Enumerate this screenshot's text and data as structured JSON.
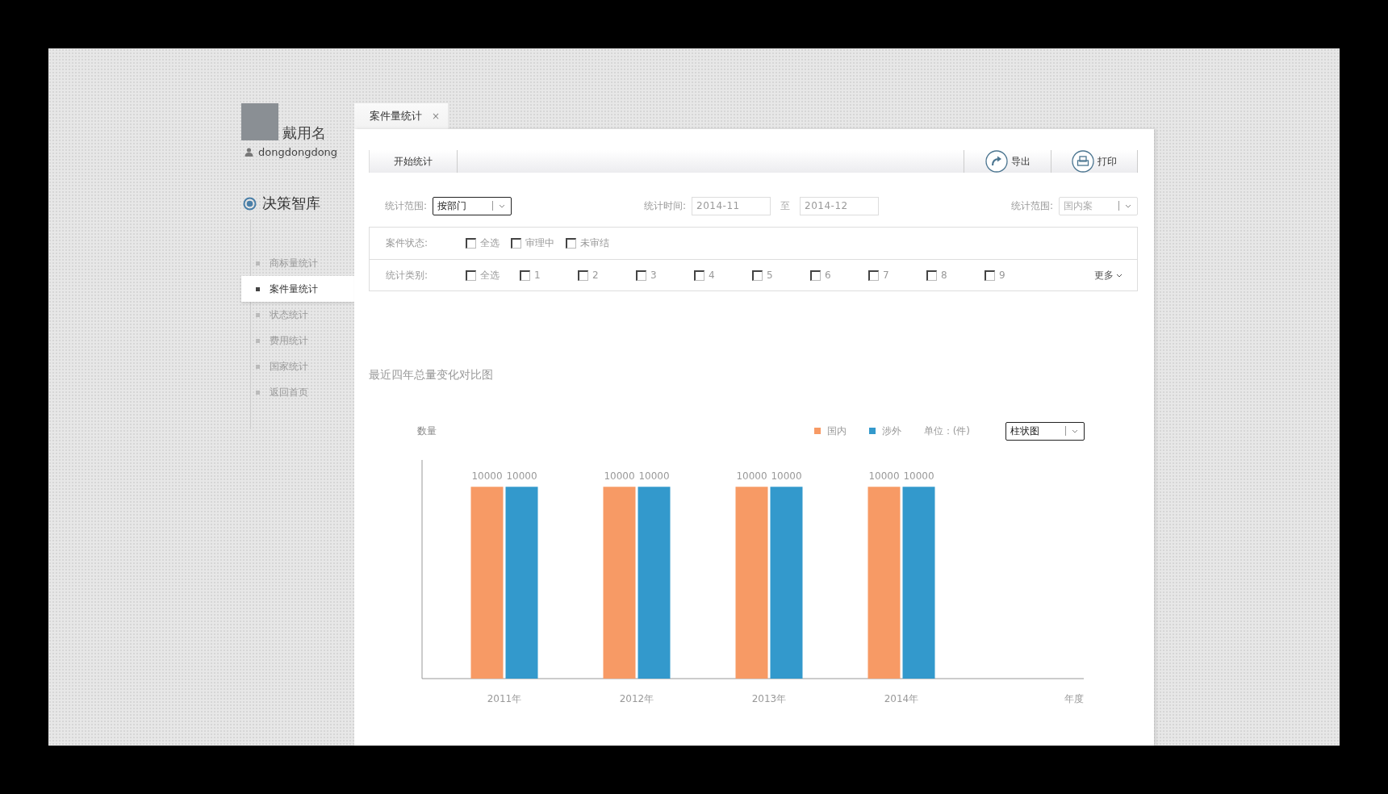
{
  "profile": {
    "name": "戴用名",
    "username": "dongdongdong"
  },
  "sidebar": {
    "title": "决策智库",
    "items": [
      {
        "label": "商标量统计",
        "selected": false
      },
      {
        "label": "案件量统计",
        "selected": true
      },
      {
        "label": "状态统计",
        "selected": false
      },
      {
        "label": "费用统计",
        "selected": false
      },
      {
        "label": "国家统计",
        "selected": false
      },
      {
        "label": "返回首页",
        "selected": false
      }
    ]
  },
  "tabs": [
    {
      "label": "案件量统计",
      "selected": true,
      "close": "×"
    }
  ],
  "toolbar": {
    "start": "开始统计",
    "actions": [
      {
        "label": "导出",
        "kind": "export"
      },
      {
        "label": "打印",
        "kind": "print"
      }
    ]
  },
  "filters": {
    "scope": {
      "label": "统计范围:",
      "value": "按部门",
      "disabled": false
    },
    "time": {
      "label": "统计时间:",
      "from": "2014-11",
      "separator": "至",
      "to": "2014-12"
    },
    "scope_right": {
      "label": "统计范围:",
      "value": "国内案",
      "disabled": true
    }
  },
  "status_row": {
    "label": "案件状态:",
    "options": [
      {
        "label": "全选",
        "checked": false
      },
      {
        "label": "审理中",
        "checked": false
      },
      {
        "label": "未审结",
        "checked": false
      }
    ]
  },
  "category_row": {
    "label": "统计类别:",
    "options": [
      {
        "label": "全选",
        "checked": false
      },
      {
        "label": "1",
        "checked": false
      },
      {
        "label": "2",
        "checked": false
      },
      {
        "label": "3",
        "checked": false
      },
      {
        "label": "4",
        "checked": false
      },
      {
        "label": "5",
        "checked": false
      },
      {
        "label": "6",
        "checked": false
      },
      {
        "label": "7",
        "checked": false
      },
      {
        "label": "8",
        "checked": false
      },
      {
        "label": "9",
        "checked": false
      }
    ],
    "more": "更多"
  },
  "chart": {
    "unit": "单位：(件)",
    "chart_type": {
      "value": "柱状图",
      "disabled": false
    },
    "chart_data": {
      "type": "bar",
      "title": "最近四年总量变化对比图",
      "annotations": [
        {
          "text": "年度"
        }
      ],
      "ylabel": "数量",
      "categories": [
        "2011年",
        "2012年",
        "2013年",
        "2014年"
      ],
      "series": [
        {
          "name": "国内",
          "color": "#f79a65",
          "values": [
            10000,
            10000,
            10000,
            10000
          ]
        },
        {
          "name": "涉外",
          "color": "#3399cc",
          "values": [
            10000,
            10000,
            10000,
            10000
          ]
        }
      ],
      "data_labels": true
    }
  }
}
